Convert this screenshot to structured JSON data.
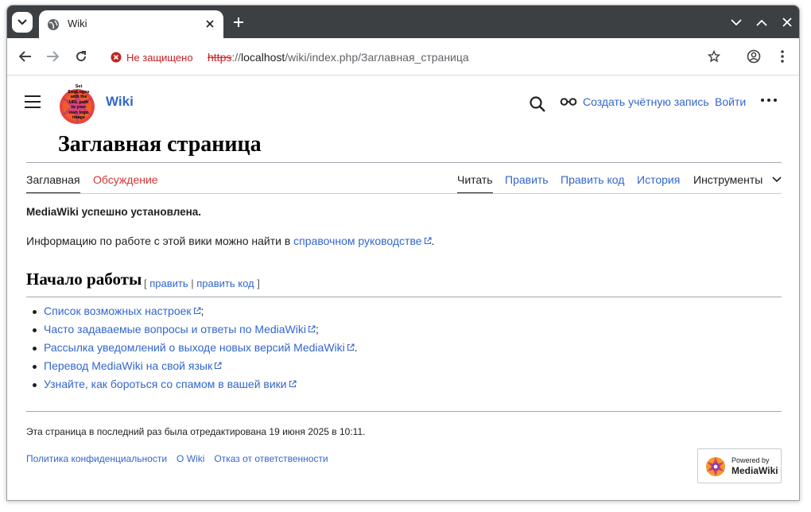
{
  "browser": {
    "tab_title": "Wiki",
    "security_label": "Не защищено",
    "url_scheme": "https",
    "url_sep": "://",
    "url_host": "localhost",
    "url_path": "/wiki/index.php/Заглавная_страница"
  },
  "header": {
    "logo_text": "Set $wgLogos with the URL path to your own logo image",
    "wordmark": "Wiki",
    "create_account": "Создать учётную запись",
    "login": "Войти"
  },
  "page": {
    "title": "Заглавная страница",
    "tabs_left": [
      {
        "label": "Заглавная"
      },
      {
        "label": "Обсуждение"
      }
    ],
    "tabs_right": [
      {
        "label": "Читать"
      },
      {
        "label": "Править"
      },
      {
        "label": "Править код"
      },
      {
        "label": "История"
      },
      {
        "label": "Инструменты"
      }
    ]
  },
  "content": {
    "success": "MediaWiki успешно установлена.",
    "info_prefix": "Информацию по работе с этой вики можно найти в ",
    "info_link": "справочном руководстве",
    "info_suffix": ".",
    "section_title": "Начало работы",
    "section_edit_open": "[ ",
    "section_edit": "править",
    "section_edit_sep": " | ",
    "section_edit_code": "править код",
    "section_edit_close": " ]",
    "list": [
      {
        "text": "Список возможных настроек",
        "suffix": ";"
      },
      {
        "text": "Часто задаваемые вопросы и ответы по MediaWiki",
        "suffix": ";"
      },
      {
        "text": "Рассылка уведомлений о выходе новых версий MediaWiki",
        "suffix": "."
      },
      {
        "text": "Перевод MediaWiki на свой язык",
        "suffix": ""
      },
      {
        "text": "Узнайте, как бороться со спамом в вашей вики",
        "suffix": ""
      }
    ]
  },
  "footer": {
    "last_edited": "Эта страница в последний раз была отредактирована 19 июня 2025 в 10:11.",
    "links": [
      "Политика конфиденциальности",
      "О Wiki",
      "Отказ от ответственности"
    ],
    "powered_line1": "Powered by",
    "powered_line2": "MediaWiki"
  }
}
